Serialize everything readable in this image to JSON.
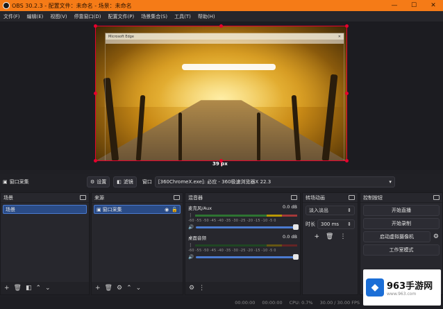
{
  "window": {
    "title": "OBS 30.2.3 - 配置文件：未命名 - 场景：未命名",
    "min": "—",
    "max": "☐",
    "close": "✕"
  },
  "menu": [
    "文件(F)",
    "编辑(E)",
    "视图(V)",
    "停靠窗口(D)",
    "配置文件(P)",
    "场景集合(S)",
    "工具(T)",
    "帮助(H)"
  ],
  "preview": {
    "offset_label": "39 px"
  },
  "browser": {
    "tab_label": "Microsoft Edge"
  },
  "context_bar": {
    "source_name": "窗口采集",
    "settings_label": "设置",
    "filters_label": "滤镜",
    "window_label": "窗口",
    "window_value": "[360ChromeX.exe]: 必应 - 360极速浏览器X 22.3"
  },
  "scenes_dock": {
    "title": "场景",
    "items": [
      "场景"
    ]
  },
  "sources_dock": {
    "title": "来源",
    "items": [
      "窗口采集"
    ]
  },
  "mixer_dock": {
    "title": "混音器",
    "channels": [
      {
        "name": "麦克风/Aux",
        "db": "0.0 dB"
      },
      {
        "name": "桌面音频",
        "db": "0.0 dB"
      }
    ],
    "ticks": "-60 -55 -50 -45 -40 -35 -30 -25 -20 -15 -10 -5 0"
  },
  "transitions_dock": {
    "title": "转场动画",
    "transition": "淡入淡出",
    "duration_label": "时长",
    "duration_value": "300 ms"
  },
  "controls_dock": {
    "title": "控制按钮",
    "buttons": [
      "开始直播",
      "开始录制",
      "启动虚拟摄像机",
      "工作室模式"
    ]
  },
  "statusbar": {
    "time1": "00:00:00",
    "time2": "00:00:00",
    "cpu": "CPU: 0.7%",
    "fps": "30.00 / 30.00 FPS"
  },
  "watermark": {
    "brand": "963手游网",
    "url": "www.963.com"
  }
}
